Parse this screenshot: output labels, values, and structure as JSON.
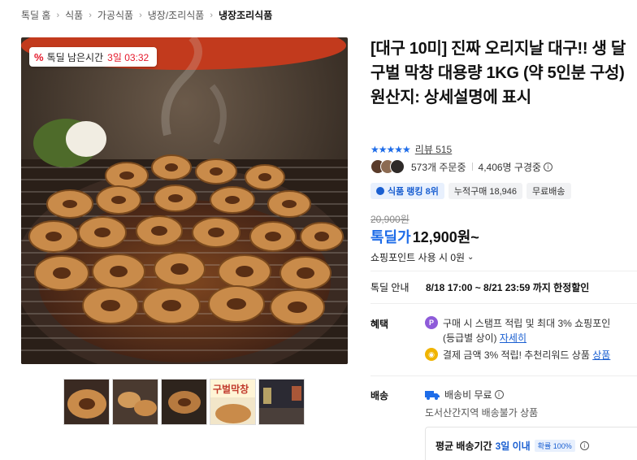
{
  "breadcrumb": [
    "톡딜 홈",
    "식품",
    "가공식품",
    "냉장/조리식품",
    "냉장조리식품"
  ],
  "badge": {
    "label": "톡딜 남은시간",
    "time": "3일 03:32",
    "icon": "percent-icon"
  },
  "title": "[대구 10미] 진짜 오리지날 대구!! 생 달구벌 막창 대용량 1KG (약 5인분 구성) 원산지: 상세설명에 표시",
  "rating": {
    "stars": "★★★★★",
    "review_text": "리뷰 515"
  },
  "orders": {
    "order_count": "573개 주문중",
    "subscriber_count": "4,406명 구경중"
  },
  "tags": {
    "rank": "식품 랭킹 8위",
    "cumulative": "누적구매 18,946",
    "free_shipping": "무료배송"
  },
  "price": {
    "original": "20,900원",
    "label": "톡딜가",
    "value": "12,900원~"
  },
  "point": {
    "text": "쇼핑포인트 사용 시 0원"
  },
  "deal_info": {
    "label": "톡딜 안내",
    "value": "8/18 17:00 ~ 8/21 23:59 까지 한정할인"
  },
  "benefits": {
    "label": "혜택",
    "item1_line1": "구매 시 스탬프 적립 및 최대 3% 쇼핑포인",
    "item1_line2_prefix": "(등급별 상이)",
    "item1_link": "자세히",
    "item2_text": "결제 금액 3% 적립! 추천리워드 상품",
    "item2_link": "상품"
  },
  "shipping": {
    "label": "배송",
    "fee": "배송비 무료",
    "note": "도서산간지역 배송불가 상품",
    "avg_label": "평균 배송기간",
    "avg_days": "3일 이내",
    "avg_pct": "확률 100%"
  },
  "colors": {
    "accent": "#1e6ce8",
    "deal_red": "#e5182a"
  }
}
